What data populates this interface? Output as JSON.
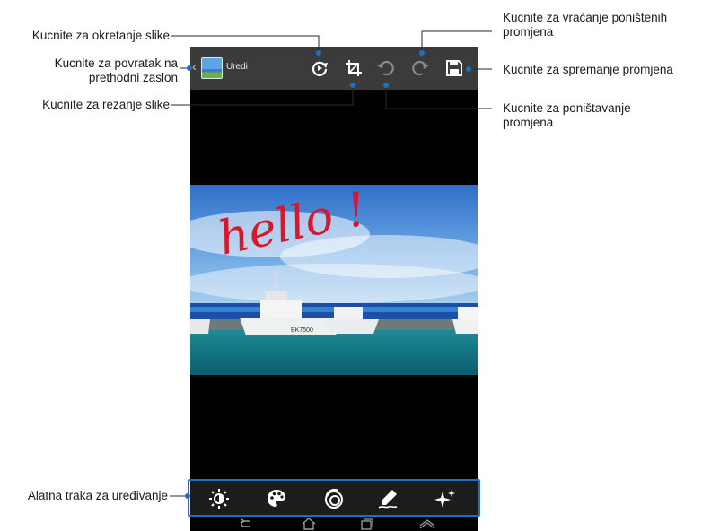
{
  "app": {
    "title": "Uredi"
  },
  "callouts": {
    "rotate": "Kucnite za okretanje slike",
    "back_line1": "Kucnite za povratak na",
    "back_line2": "prethodni zaslon",
    "crop": "Kucnite za rezanje slike",
    "redo_line1": "Kucnite za vraćanje poništenih",
    "redo_line2": "promjena",
    "save": "Kucnite za spremanje promjena",
    "undo_line1": "Kucnite za poništavanje",
    "undo_line2": "promjena",
    "toolbar": "Alatna traka za uređivanje"
  },
  "photo": {
    "handwriting": "hello !",
    "boat_label": "BK7500"
  },
  "colors": {
    "frame": "#1d6fc4",
    "topbar": "#3b3b3b",
    "ink": "#d8182a"
  }
}
